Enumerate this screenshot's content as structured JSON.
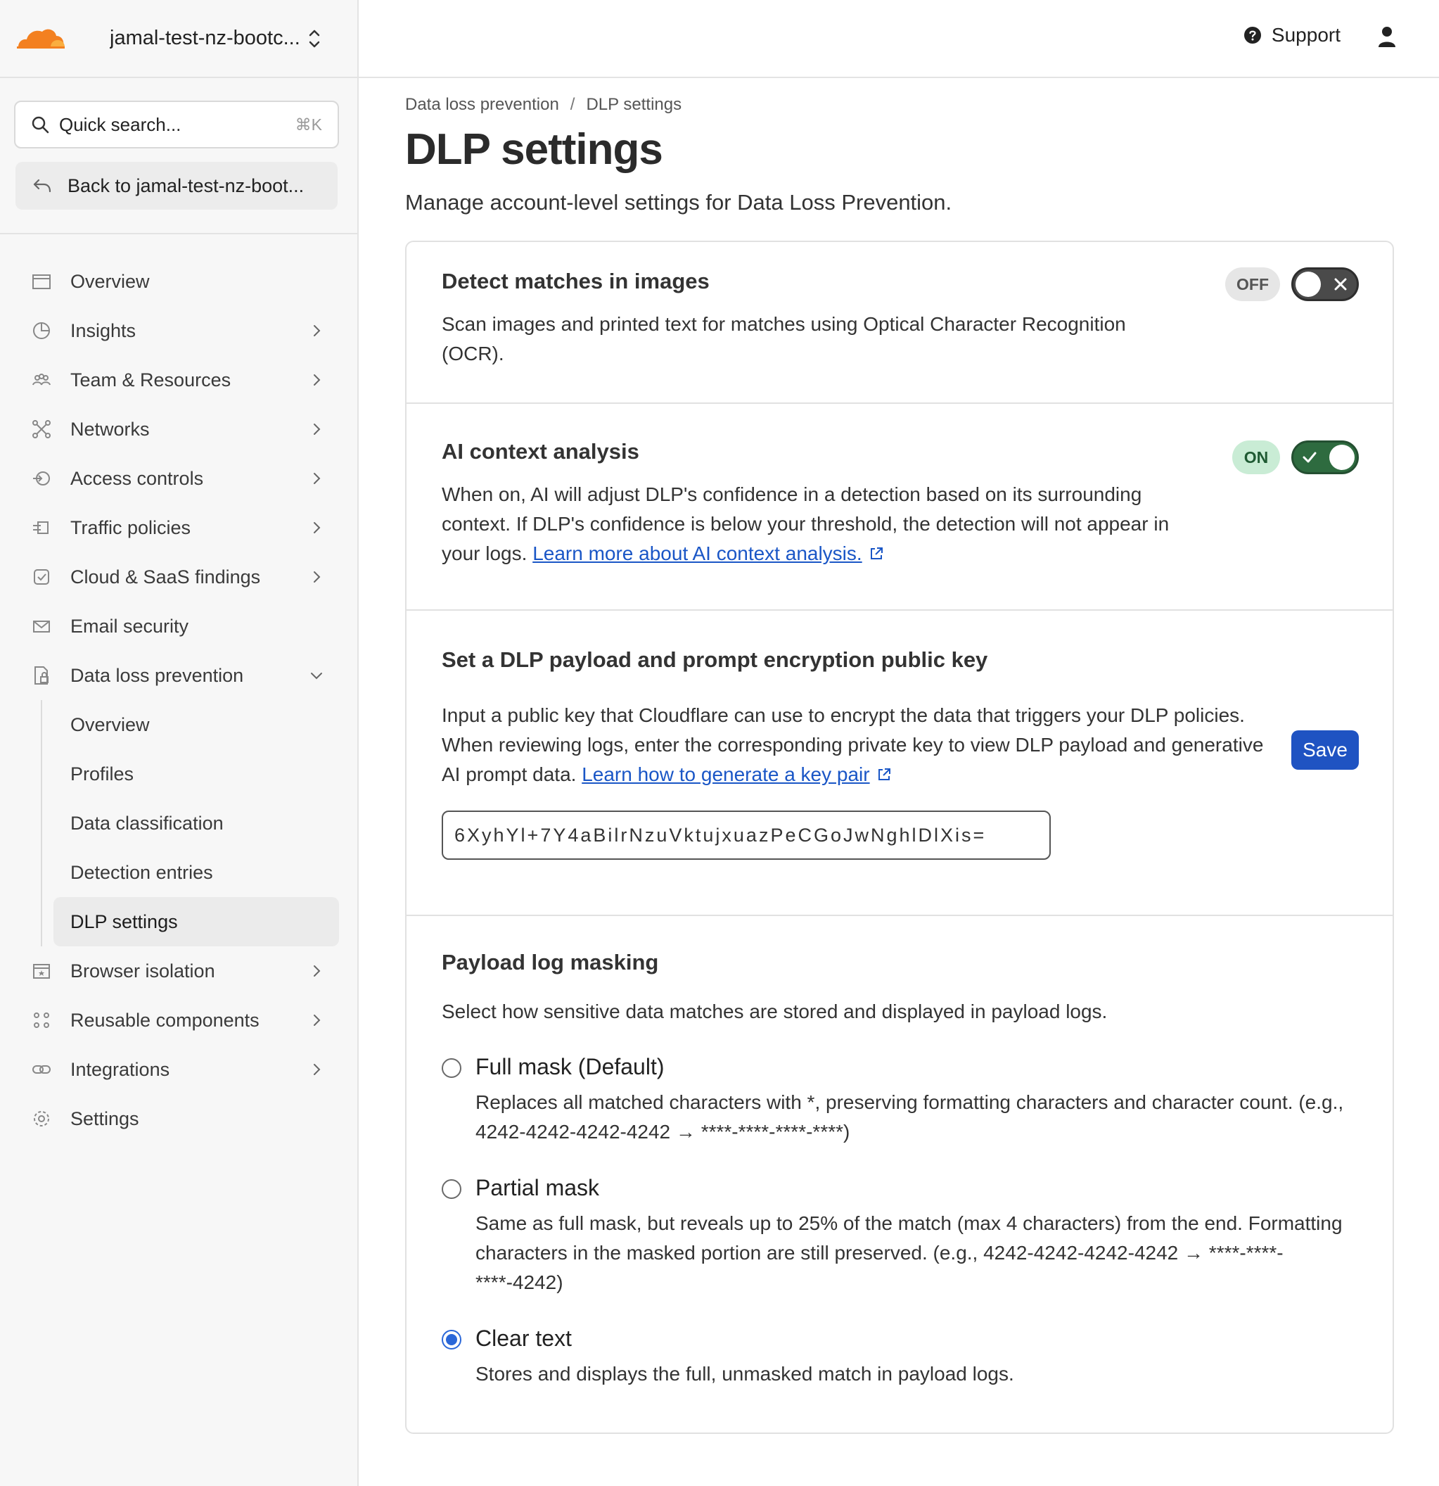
{
  "header": {
    "account_name": "jamal-test-nz-bootc...",
    "support_label": "Support"
  },
  "sidebar": {
    "search_placeholder": "Quick search...",
    "search_shortcut": "⌘K",
    "back_label": "Back to jamal-test-nz-boot...",
    "items": [
      {
        "label": "Overview",
        "icon": "window-icon",
        "has_chevron": false
      },
      {
        "label": "Insights",
        "icon": "pie-chart-icon",
        "has_chevron": true
      },
      {
        "label": "Team & Resources",
        "icon": "people-icon",
        "has_chevron": true
      },
      {
        "label": "Networks",
        "icon": "network-icon",
        "has_chevron": true
      },
      {
        "label": "Access controls",
        "icon": "access-icon",
        "has_chevron": true
      },
      {
        "label": "Traffic policies",
        "icon": "traffic-icon",
        "has_chevron": true
      },
      {
        "label": "Cloud & SaaS findings",
        "icon": "cloud-check-icon",
        "has_chevron": true
      },
      {
        "label": "Email security",
        "icon": "email-shield-icon",
        "has_chevron": false
      },
      {
        "label": "Data loss prevention",
        "icon": "document-lock-icon",
        "expanded": true
      },
      {
        "label": "Browser isolation",
        "icon": "browser-icon",
        "has_chevron": true
      },
      {
        "label": "Reusable components",
        "icon": "components-icon",
        "has_chevron": true
      },
      {
        "label": "Integrations",
        "icon": "link-icon",
        "has_chevron": true
      },
      {
        "label": "Settings",
        "icon": "gear-icon",
        "has_chevron": false
      }
    ],
    "dlp_subitems": [
      "Overview",
      "Profiles",
      "Data classification",
      "Detection entries",
      "DLP settings"
    ],
    "active_subitem": "DLP settings"
  },
  "main": {
    "breadcrumb": [
      "Data loss prevention",
      "DLP settings"
    ],
    "title": "DLP settings",
    "description": "Manage account-level settings for Data Loss Prevention.",
    "ocr": {
      "title": "Detect matches in images",
      "text": "Scan images and printed text for matches using Optical Character Recognition (OCR).",
      "status": "OFF",
      "enabled": false
    },
    "ai": {
      "title": "AI context analysis",
      "text": "When on, AI will adjust DLP's confidence in a detection based on its surrounding context. If DLP's confidence is below your threshold, the detection will not appear in your logs.",
      "link": "Learn more about AI context analysis.",
      "status": "ON",
      "enabled": true
    },
    "encryption": {
      "title": "Set a DLP payload and prompt encryption public key",
      "text": "Input a public key that Cloudflare can use to encrypt the data that triggers your DLP policies. When reviewing logs, enter the corresponding private key to view DLP payload and generative AI prompt data.",
      "link": "Learn how to generate a key pair",
      "key_value": "6XyhYl+7Y4aBilrNzuVktujxuazPeCGoJwNghlDlXis=",
      "save_label": "Save"
    },
    "masking": {
      "title": "Payload log masking",
      "description": "Select how sensitive data matches are stored and displayed in payload logs.",
      "options": [
        {
          "label": "Full mask (Default)",
          "desc": "Replaces all matched characters with *, preserving formatting characters and character count. (e.g., 4242-4242-4242-4242 → ****-****-****-****)"
        },
        {
          "label": "Partial mask",
          "desc": "Same as full mask, but reveals up to 25% of the match (max 4 characters) from the end. Formatting characters in the masked portion are still preserved. (e.g., 4242-4242-4242-4242 → ****-****-****-4242)"
        },
        {
          "label": "Clear text",
          "desc": "Stores and displays the full, unmasked match in payload logs."
        }
      ],
      "selected": "Clear text"
    }
  },
  "colors": {
    "brand_orange": "#f38020",
    "link_blue": "#1a56c6",
    "save_button": "#1f53c2",
    "toggle_on": "#2e6b3f",
    "radio_selected": "#2a67d8"
  }
}
